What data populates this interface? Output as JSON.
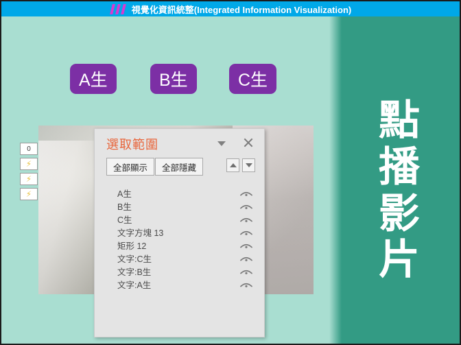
{
  "titlebar": {
    "logo_icon": "w-logo-icon",
    "title": "視覺化資訊統整(Integrated Information Visualization)",
    "background": "#00a8e8",
    "logo_color": "#d73ad0"
  },
  "slide": {
    "background": "#a9ded1",
    "right_panel": {
      "background": "#339b84",
      "vertical_text": "點\n播\n影\n片",
      "text_color": "#ffffff"
    },
    "pills": [
      {
        "label": "A生",
        "name": "pill-a"
      },
      {
        "label": "B生",
        "name": "pill-b"
      },
      {
        "label": "C生",
        "name": "pill-c"
      }
    ],
    "pill_color": "#7c2fa5",
    "video_placeholder_name": "video-frame"
  },
  "thumbnails": [
    {
      "label": "0",
      "icon": "slide-number-thumbnail"
    },
    {
      "label": "",
      "icon": "lightning-bolt-icon"
    },
    {
      "label": "",
      "icon": "lightning-bolt-icon"
    },
    {
      "label": "",
      "icon": "lightning-bolt-icon"
    }
  ],
  "bolt_glyph": "⚡",
  "selection_pane": {
    "title": "選取範圍",
    "title_color": "#e8663c",
    "dropdown_icon": "chevron-down-icon",
    "close_icon": "close-icon",
    "show_all_label": "全部顯示",
    "hide_all_label": "全部隱藏",
    "move_up_icon": "triangle-up-icon",
    "move_down_icon": "triangle-down-icon",
    "items": [
      {
        "label": "A生",
        "visible": true
      },
      {
        "label": "B生",
        "visible": true
      },
      {
        "label": "C生",
        "visible": true
      },
      {
        "label": "文字方塊 13",
        "visible": true
      },
      {
        "label": "矩形 12",
        "visible": true
      },
      {
        "label": "文字:C生",
        "visible": true
      },
      {
        "label": "文字:B生",
        "visible": true
      },
      {
        "label": "文字:A生",
        "visible": true
      }
    ],
    "eye_icon": "eye-visible-icon"
  }
}
